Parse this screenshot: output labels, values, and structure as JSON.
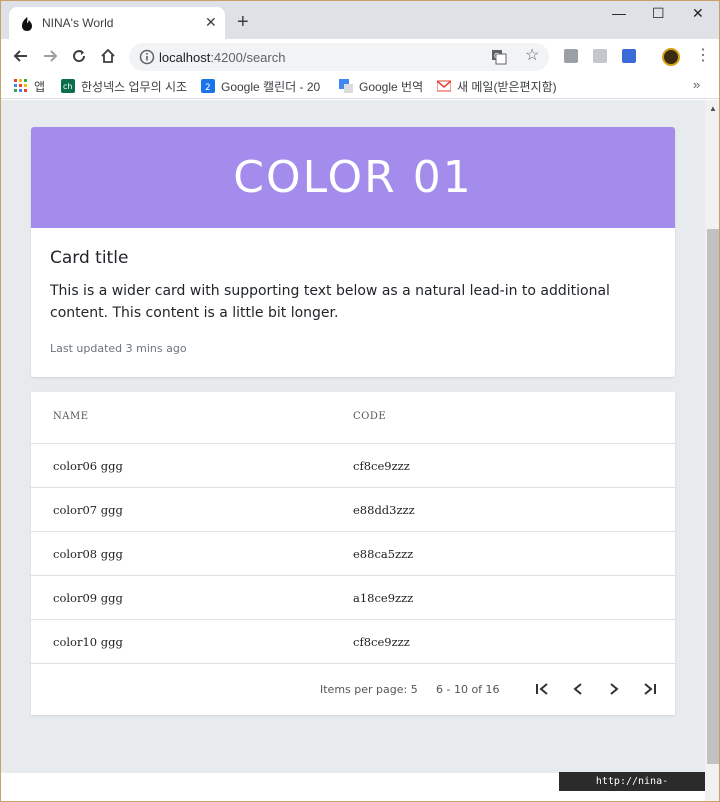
{
  "browser": {
    "tab_title": "NINA's World",
    "url_host": "localhost",
    "url_path": ":4200/search",
    "bookmarks": [
      {
        "label": "앱",
        "icon": "apps-grid-icon"
      },
      {
        "label": "한성넥스 업무의 시조",
        "icon": "site-favicon-icon"
      },
      {
        "label": "Google 캘린더 - 20",
        "icon": "calendar-icon"
      },
      {
        "label": "Google 번역",
        "icon": "translate-icon"
      },
      {
        "label": "새 메일(받은편지함)",
        "icon": "gmail-icon"
      }
    ]
  },
  "card": {
    "banner_text": "COLOR 01",
    "banner_color": "#a38ceb",
    "title": "Card title",
    "text": "This is a wider card with supporting text below as a natural lead-in to additional content. This content is a little bit longer.",
    "meta": "Last updated 3 mins ago"
  },
  "table": {
    "headers": [
      "NAME",
      "CODE"
    ],
    "rows": [
      {
        "name": "color06 ggg",
        "code": "cf8ce9zzz"
      },
      {
        "name": "color07 ggg",
        "code": "e88dd3zzz"
      },
      {
        "name": "color08 ggg",
        "code": "e88ca5zzz"
      },
      {
        "name": "color09 ggg",
        "code": "a18ce9zzz"
      },
      {
        "name": "color10 ggg",
        "code": "cf8ce9zzz"
      }
    ]
  },
  "paginator": {
    "items_per_page": "Items per page: 5",
    "range": "6 - 10 of 16"
  },
  "watermark": "http://nina-life.tistory.com"
}
